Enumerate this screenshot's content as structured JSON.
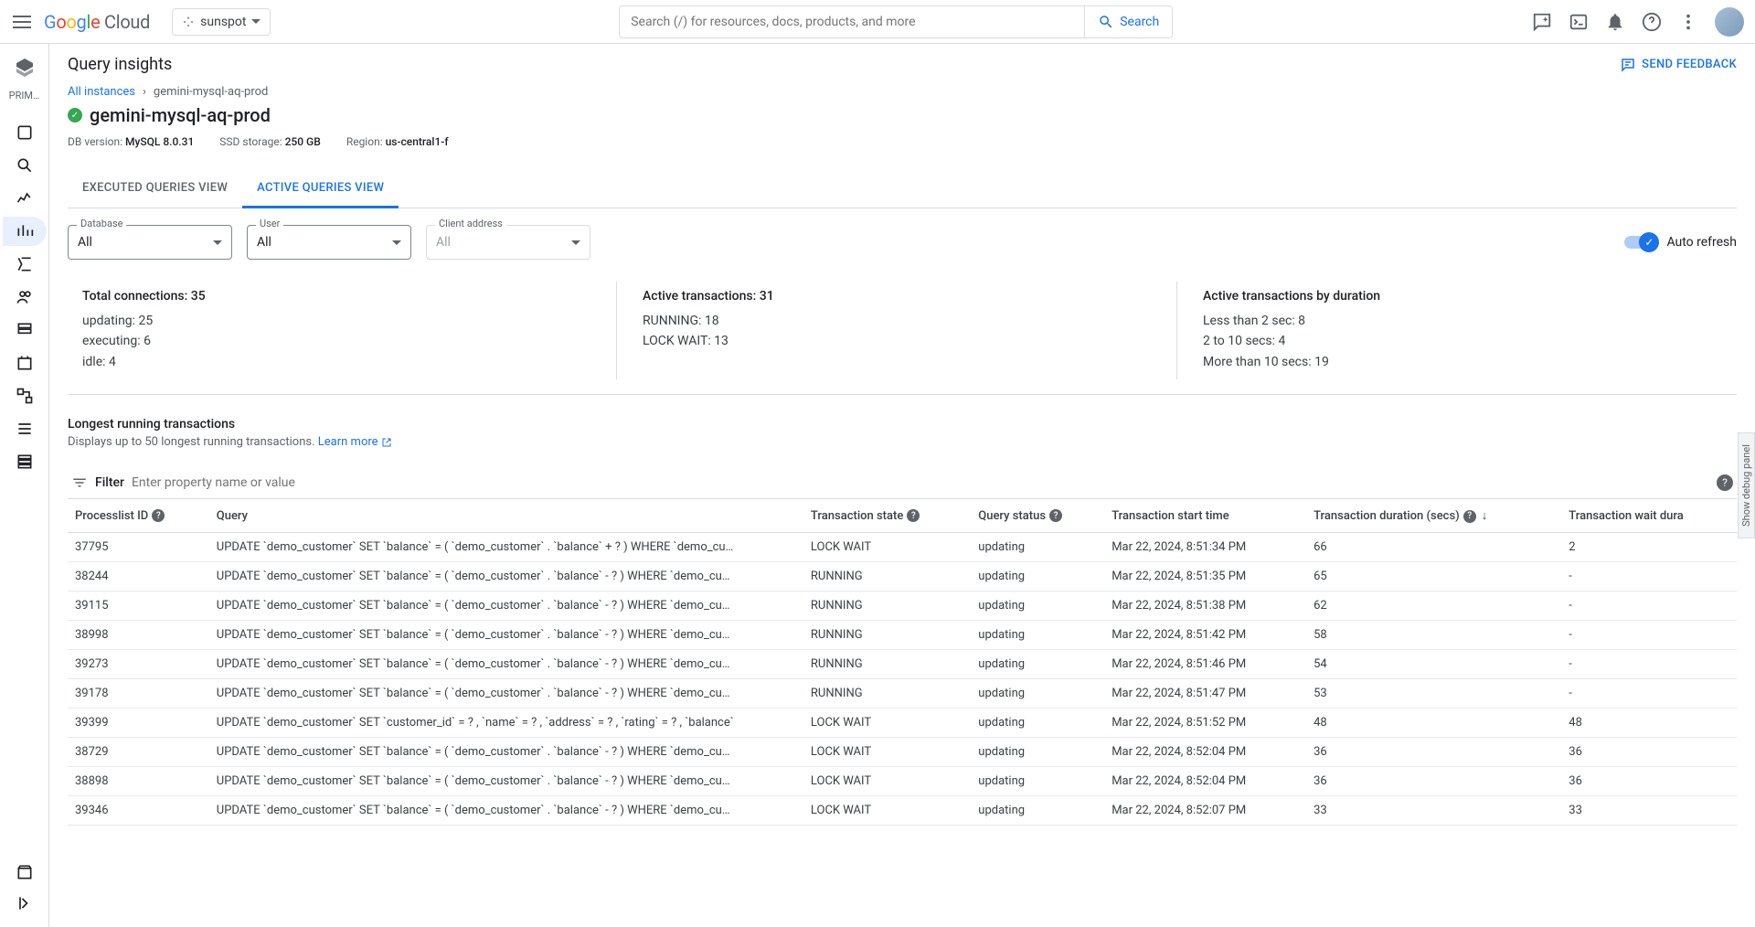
{
  "header": {
    "logo": "Google Cloud",
    "project": "sunspot",
    "search_placeholder": "Search (/) for resources, docs, products, and more",
    "search_button": "Search"
  },
  "sidenav": {
    "section": "PRIM…"
  },
  "page": {
    "title": "Query insights",
    "feedback": "SEND FEEDBACK"
  },
  "breadcrumb": {
    "root": "All instances",
    "current": "gemini-mysql-aq-prod"
  },
  "instance": {
    "name": "gemini-mysql-aq-prod",
    "db_version_label": "DB version:",
    "db_version": "MySQL 8.0.31",
    "storage_label": "SSD storage:",
    "storage": "250 GB",
    "region_label": "Region:",
    "region": "us-central1-f"
  },
  "tabs": {
    "executed": "EXECUTED QUERIES VIEW",
    "active": "ACTIVE QUERIES VIEW"
  },
  "filters": {
    "database_label": "Database",
    "database_value": "All",
    "user_label": "User",
    "user_value": "All",
    "client_label": "Client address",
    "client_value": "All",
    "auto_refresh": "Auto refresh"
  },
  "stats": {
    "connections_title": "Total connections: 35",
    "connections_lines": [
      "updating: 25",
      "executing: 6",
      "idle: 4"
    ],
    "active_title": "Active transactions: 31",
    "active_lines": [
      "RUNNING: 18",
      "LOCK WAIT: 13"
    ],
    "duration_title": "Active transactions by duration",
    "duration_lines": [
      "Less than 2 sec: 8",
      "2 to 10 secs: 4",
      "More than 10 secs: 19"
    ]
  },
  "table_section": {
    "title": "Longest running transactions",
    "desc": "Displays up to 50 longest running transactions. ",
    "learn_more": "Learn more",
    "filter_label": "Filter",
    "filter_placeholder": "Enter property name or value"
  },
  "columns": {
    "id": "Processlist ID",
    "query": "Query",
    "state": "Transaction state",
    "status": "Query status",
    "start": "Transaction start time",
    "duration": "Transaction duration (secs)",
    "wait": "Transaction wait dura"
  },
  "rows": [
    {
      "id": "37795",
      "query": "UPDATE `demo_customer` SET `balance` = ( `demo_customer` . `balance` + ? ) WHERE `demo_cu…",
      "state": "LOCK WAIT",
      "status": "updating",
      "start": "Mar 22, 2024, 8:51:34 PM",
      "duration": "66",
      "wait": "2"
    },
    {
      "id": "38244",
      "query": "UPDATE `demo_customer` SET `balance` = ( `demo_customer` . `balance` - ? ) WHERE `demo_cu…",
      "state": "RUNNING",
      "status": "updating",
      "start": "Mar 22, 2024, 8:51:35 PM",
      "duration": "65",
      "wait": "-"
    },
    {
      "id": "39115",
      "query": "UPDATE `demo_customer` SET `balance` = ( `demo_customer` . `balance` - ? ) WHERE `demo_cu…",
      "state": "RUNNING",
      "status": "updating",
      "start": "Mar 22, 2024, 8:51:38 PM",
      "duration": "62",
      "wait": "-"
    },
    {
      "id": "38998",
      "query": "UPDATE `demo_customer` SET `balance` = ( `demo_customer` . `balance` - ? ) WHERE `demo_cu…",
      "state": "RUNNING",
      "status": "updating",
      "start": "Mar 22, 2024, 8:51:42 PM",
      "duration": "58",
      "wait": "-"
    },
    {
      "id": "39273",
      "query": "UPDATE `demo_customer` SET `balance` = ( `demo_customer` . `balance` - ? ) WHERE `demo_cu…",
      "state": "RUNNING",
      "status": "updating",
      "start": "Mar 22, 2024, 8:51:46 PM",
      "duration": "54",
      "wait": "-"
    },
    {
      "id": "39178",
      "query": "UPDATE `demo_customer` SET `balance` = ( `demo_customer` . `balance` - ? ) WHERE `demo_cu…",
      "state": "RUNNING",
      "status": "updating",
      "start": "Mar 22, 2024, 8:51:47 PM",
      "duration": "53",
      "wait": "-"
    },
    {
      "id": "39399",
      "query": "UPDATE `demo_customer` SET `customer_id` = ? , `name` = ? , `address` = ? , `rating` = ? , `balance`",
      "state": "LOCK WAIT",
      "status": "updating",
      "start": "Mar 22, 2024, 8:51:52 PM",
      "duration": "48",
      "wait": "48"
    },
    {
      "id": "38729",
      "query": "UPDATE `demo_customer` SET `balance` = ( `demo_customer` . `balance` - ? ) WHERE `demo_cu…",
      "state": "LOCK WAIT",
      "status": "updating",
      "start": "Mar 22, 2024, 8:52:04 PM",
      "duration": "36",
      "wait": "36"
    },
    {
      "id": "38898",
      "query": "UPDATE `demo_customer` SET `balance` = ( `demo_customer` . `balance` - ? ) WHERE `demo_cu…",
      "state": "LOCK WAIT",
      "status": "updating",
      "start": "Mar 22, 2024, 8:52:04 PM",
      "duration": "36",
      "wait": "36"
    },
    {
      "id": "39346",
      "query": "UPDATE `demo_customer` SET `balance` = ( `demo_customer` . `balance` - ? ) WHERE `demo_cu…",
      "state": "LOCK WAIT",
      "status": "updating",
      "start": "Mar 22, 2024, 8:52:07 PM",
      "duration": "33",
      "wait": "33"
    }
  ],
  "debug_panel": "Show debug panel"
}
